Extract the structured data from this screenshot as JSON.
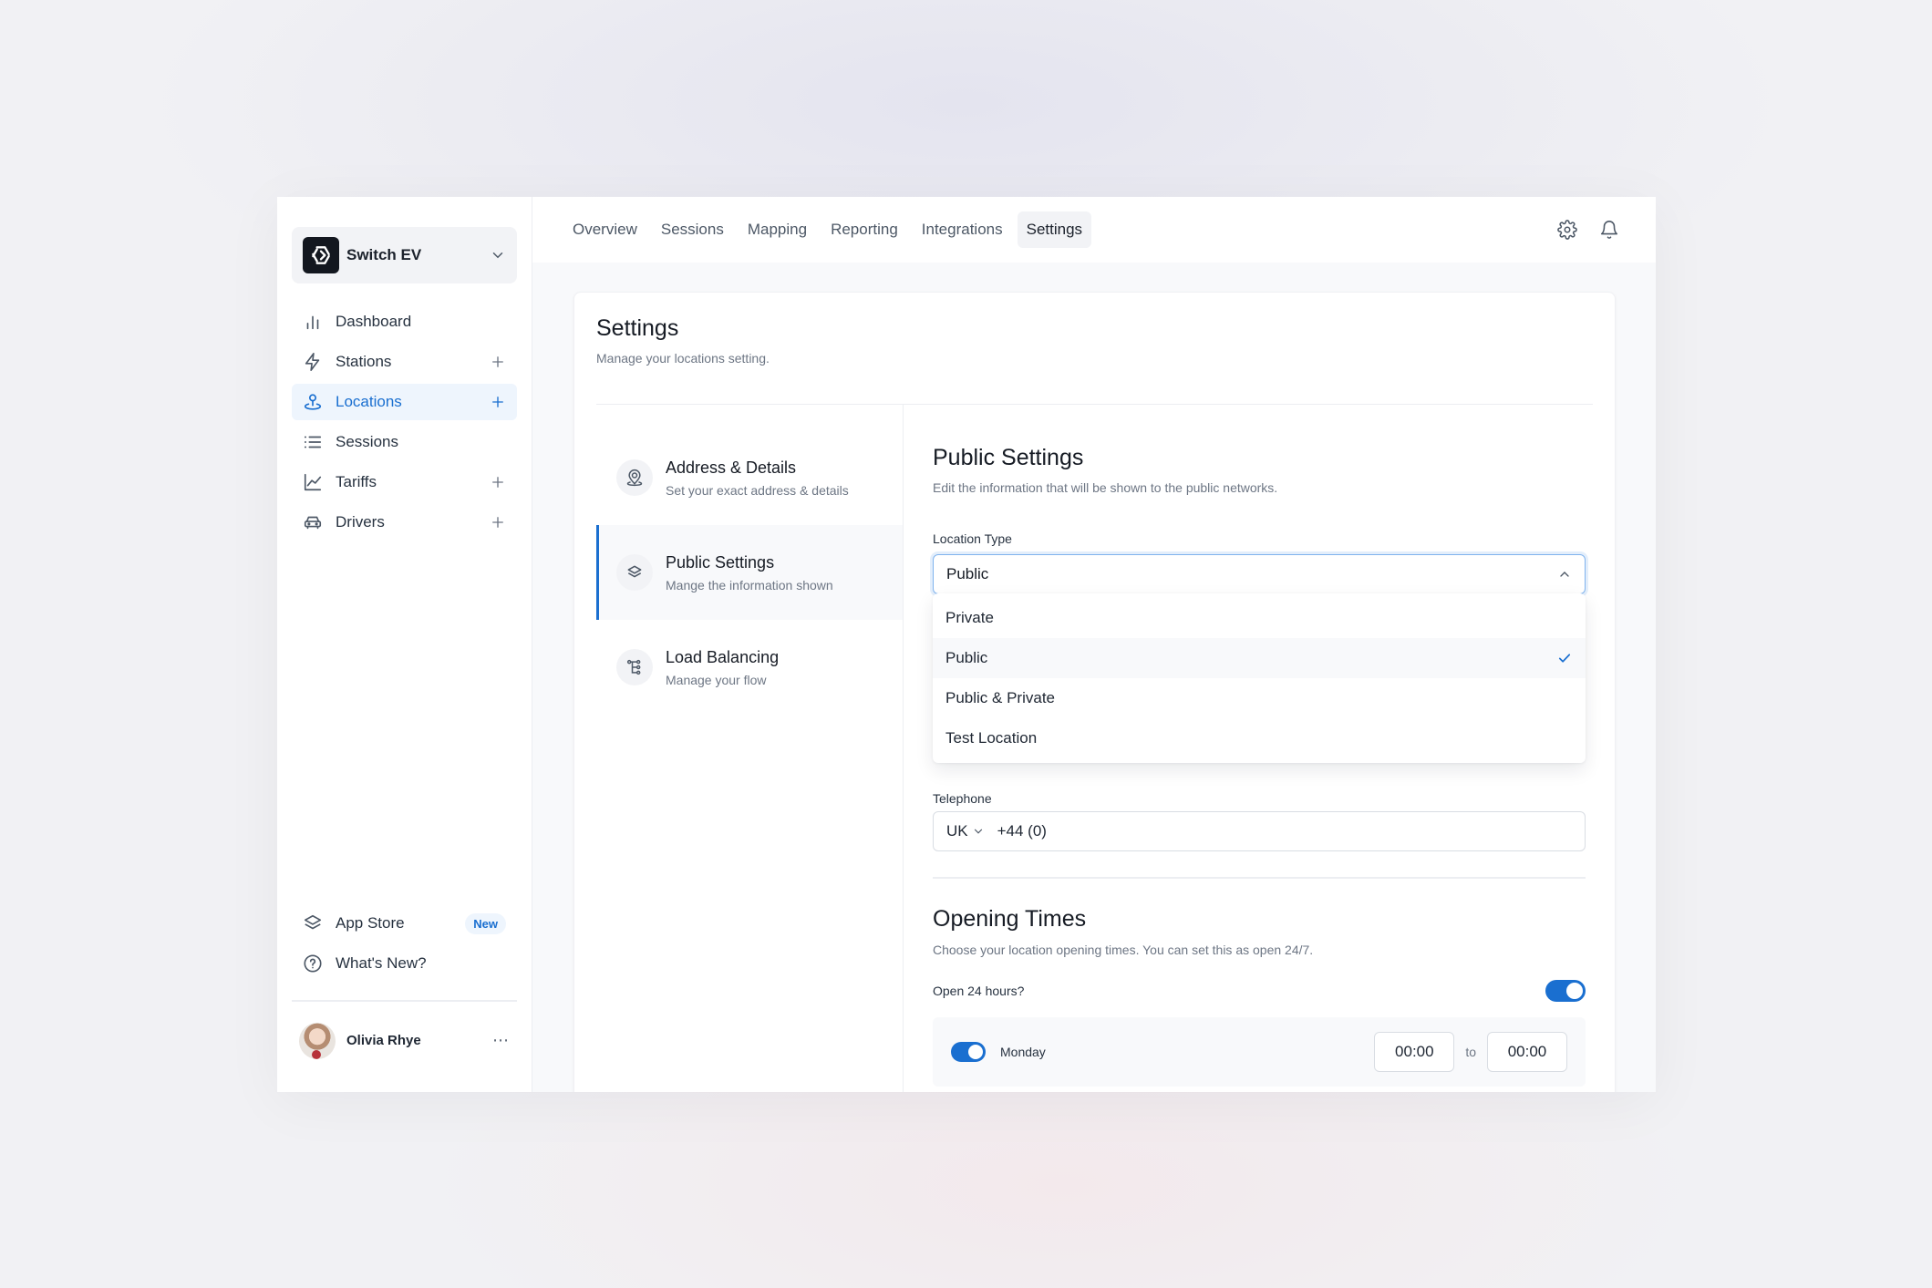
{
  "brand": {
    "name": "Switch EV"
  },
  "sidebar": {
    "items": [
      {
        "label": "Dashboard",
        "icon": "bar-chart-icon",
        "plus": false
      },
      {
        "label": "Stations",
        "icon": "lightning-icon",
        "plus": true
      },
      {
        "label": "Locations",
        "icon": "location-pin-icon",
        "plus": true,
        "active": true
      },
      {
        "label": "Sessions",
        "icon": "list-icon",
        "plus": false
      },
      {
        "label": "Tariffs",
        "icon": "line-chart-icon",
        "plus": true
      },
      {
        "label": "Drivers",
        "icon": "car-icon",
        "plus": true
      }
    ],
    "bottom": [
      {
        "label": "App Store",
        "icon": "layers-icon",
        "badge": "New"
      },
      {
        "label": "What's New?",
        "icon": "help-circle-icon"
      }
    ],
    "user": {
      "name": "Olivia Rhye"
    }
  },
  "topnav": {
    "tabs": [
      "Overview",
      "Sessions",
      "Mapping",
      "Reporting",
      "Integrations",
      "Settings"
    ],
    "active": "Settings"
  },
  "settings": {
    "title": "Settings",
    "subtitle": "Manage your locations setting.",
    "subnav": [
      {
        "title": "Address & Details",
        "desc": "Set your exact address & details",
        "icon": "map-pin-icon"
      },
      {
        "title": "Public Settings",
        "desc": "Mange the information shown",
        "icon": "layers-icon",
        "active": true
      },
      {
        "title": "Load Balancing",
        "desc": "Manage your flow",
        "icon": "flow-icon"
      }
    ]
  },
  "public_settings": {
    "title": "Public Settings",
    "subtitle": "Edit the information that will be shown to the public networks.",
    "location_type_label": "Location Type",
    "location_type_value": "Public",
    "options": [
      "Private",
      "Public",
      "Public & Private",
      "Test Location"
    ],
    "selected_option": "Public",
    "telephone_label": "Telephone",
    "country_code": "UK",
    "phone_prefix": "+44 (0)"
  },
  "opening_times": {
    "title": "Opening Times",
    "subtitle": "Choose your location opening times. You can set this as open 24/7.",
    "open24_label": "Open 24 hours?",
    "open24": true,
    "days": [
      {
        "name": "Monday",
        "enabled": true,
        "from": "00:00",
        "to_label": "to",
        "to": "00:00"
      }
    ]
  },
  "colors": {
    "accent": "#1a6fd0",
    "active_bg": "#eef5fd"
  }
}
